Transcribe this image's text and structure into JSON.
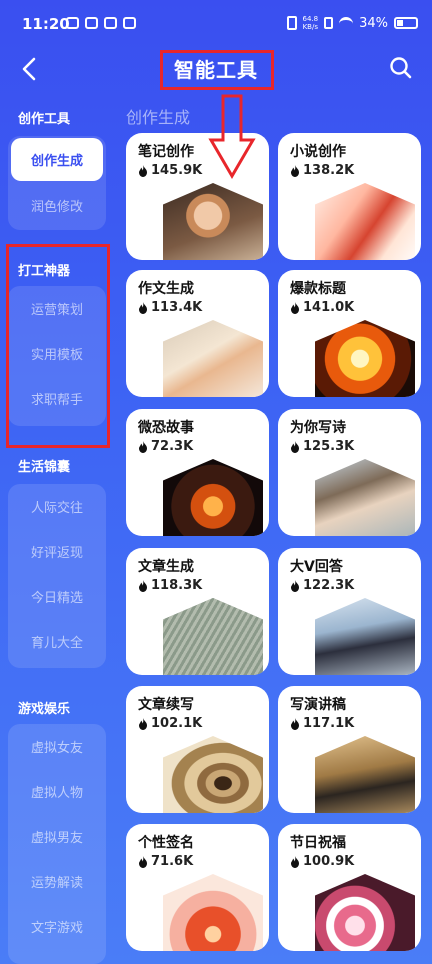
{
  "status": {
    "time": "11:20",
    "network_speed_value": "64.8",
    "network_speed_unit": "KB/s",
    "battery": "34%"
  },
  "header": {
    "title": "智能工具"
  },
  "sidebar": {
    "categories": [
      {
        "title": "创作工具",
        "items": [
          "创作生成",
          "润色修改"
        ],
        "active": 0
      },
      {
        "title": "打工神器",
        "items": [
          "运营策划",
          "实用模板",
          "求职帮手"
        ]
      },
      {
        "title": "生活锦囊",
        "items": [
          "人际交往",
          "好评返现",
          "今日精选",
          "育儿大全"
        ]
      },
      {
        "title": "游戏娱乐",
        "items": [
          "虚拟女友",
          "虚拟人物",
          "虚拟男友",
          "运势解读",
          "文字游戏"
        ]
      }
    ]
  },
  "main": {
    "section_title": "创作生成",
    "cards": [
      {
        "title": "笔记创作",
        "count": "145.9K",
        "image": "woman-portrait"
      },
      {
        "title": "小说创作",
        "count": "138.2K",
        "image": "pen-and-red-light"
      },
      {
        "title": "作文生成",
        "count": "113.4K",
        "image": "hand-writing"
      },
      {
        "title": "爆款标题",
        "count": "141.0K",
        "image": "fire-explosion"
      },
      {
        "title": "微恐故事",
        "count": "72.3K",
        "image": "jack-o-lantern-robot"
      },
      {
        "title": "为你写诗",
        "count": "125.3K",
        "image": "man-writing-poem"
      },
      {
        "title": "文章生成",
        "count": "118.3K",
        "image": "paper-wave"
      },
      {
        "title": "大V回答",
        "count": "122.3K",
        "image": "men-with-umbrella"
      },
      {
        "title": "文章续写",
        "count": "102.1K",
        "image": "rolled-paper"
      },
      {
        "title": "写演讲稿",
        "count": "117.1K",
        "image": "man-at-podium"
      },
      {
        "title": "个性签名",
        "count": "71.6K",
        "image": "red-flower"
      },
      {
        "title": "节日祝福",
        "count": "100.9K",
        "image": "flower-bouquet"
      }
    ]
  }
}
